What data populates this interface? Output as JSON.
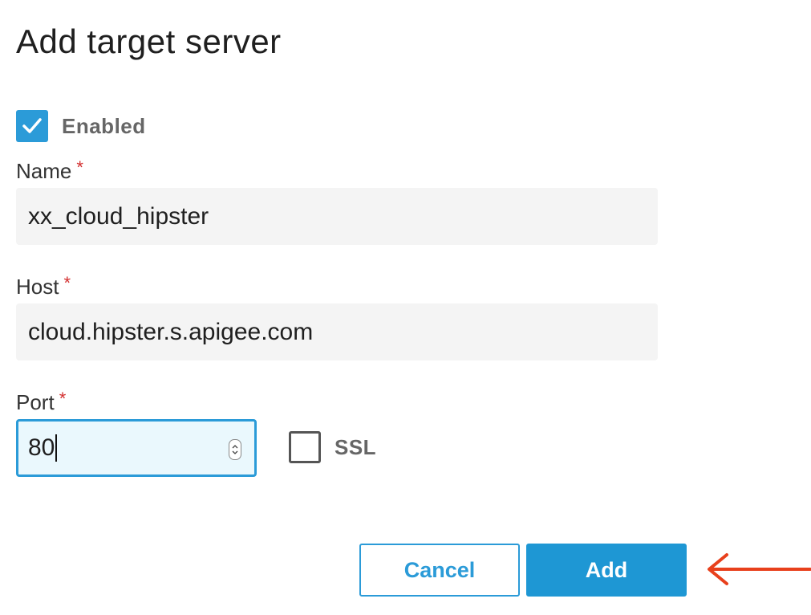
{
  "dialog": {
    "title": "Add target server"
  },
  "enabled": {
    "label": "Enabled",
    "checked": true
  },
  "name": {
    "label": "Name",
    "required_marker": "*",
    "value": "xx_cloud_hipster"
  },
  "host": {
    "label": "Host",
    "required_marker": "*",
    "value": "cloud.hipster.s.apigee.com"
  },
  "port": {
    "label": "Port",
    "required_marker": "*",
    "value": "80"
  },
  "ssl": {
    "label": "SSL",
    "checked": false
  },
  "actions": {
    "cancel_label": "Cancel",
    "add_label": "Add"
  },
  "colors": {
    "accent": "#2b9bd8",
    "required": "#d32f2f",
    "annotation_arrow": "#e8401c"
  },
  "annotation": {
    "icon": "left-arrow-icon"
  }
}
